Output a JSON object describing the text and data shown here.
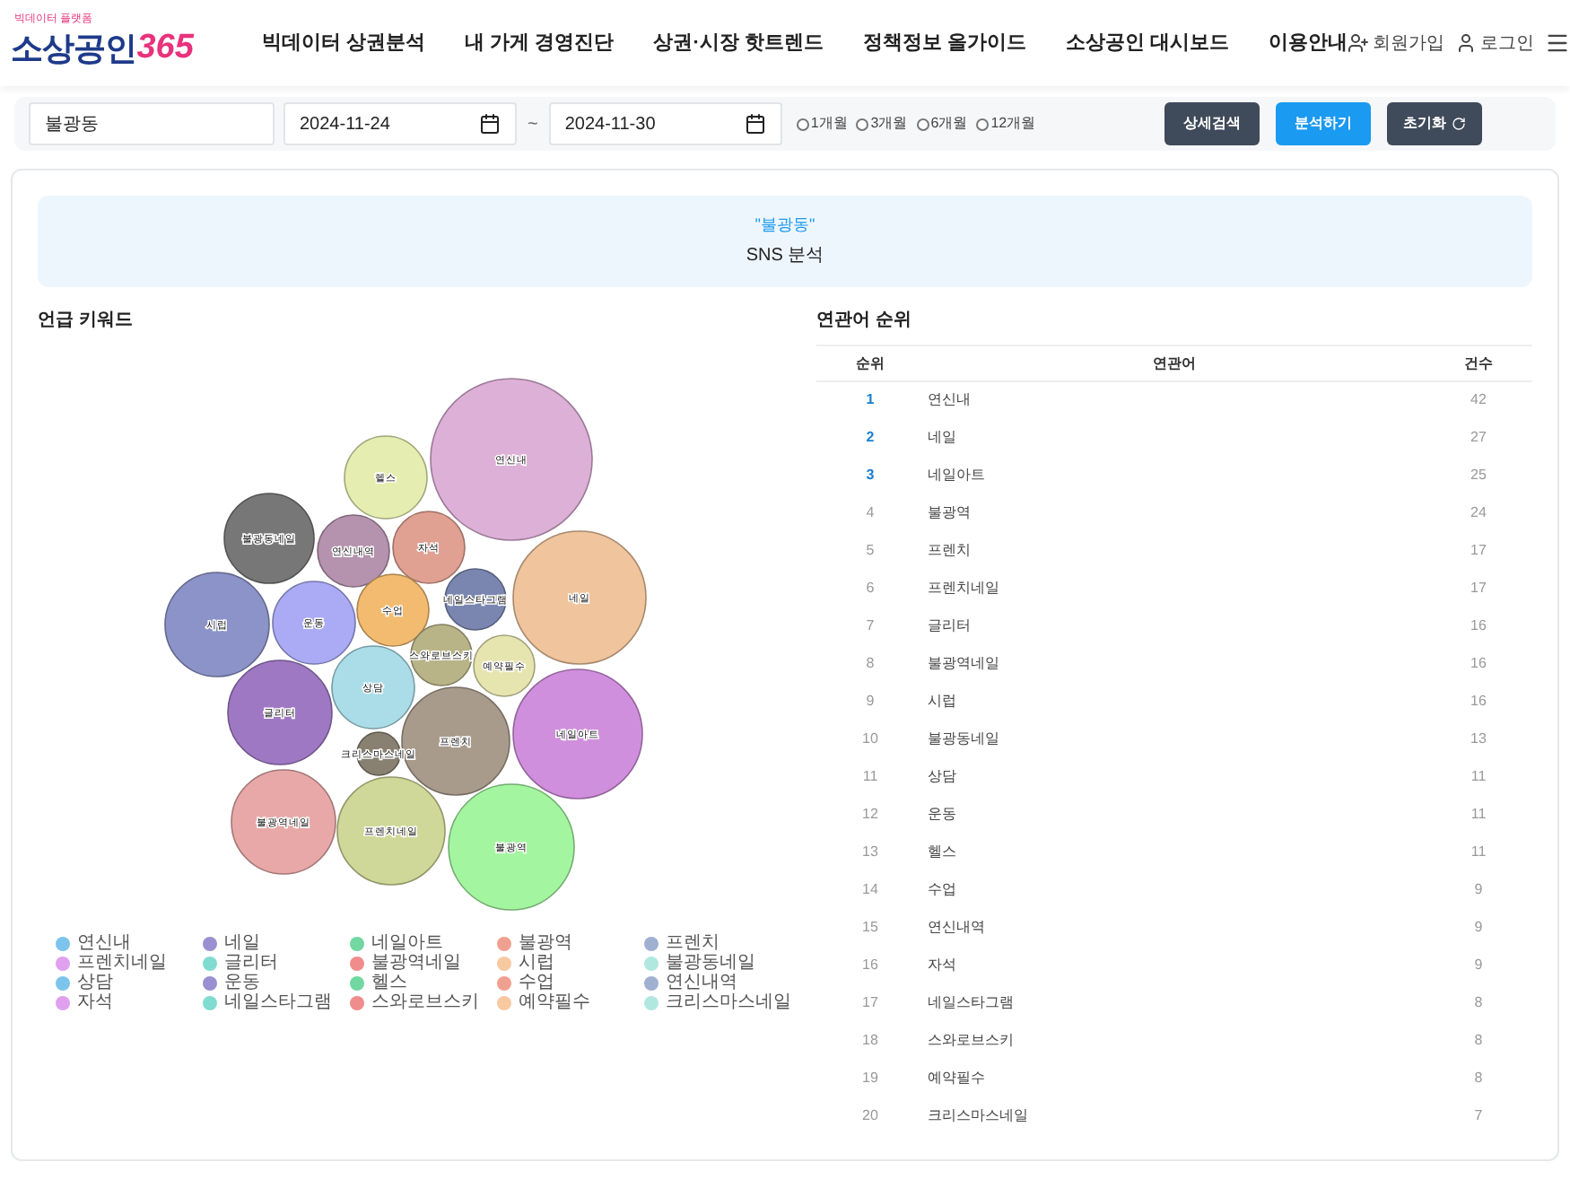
{
  "header": {
    "logo": {
      "tagline": "빅데이터 플랫폼",
      "name": "소상공인",
      "number": "365"
    },
    "nav": [
      "빅데이터 상권분석",
      "내 가게 경영진단",
      "상권·시장 핫트렌드",
      "정책정보 올가이드",
      "소상공인 대시보드",
      "이용안내"
    ],
    "user_links": [
      {
        "kind": "signup",
        "label": "회원가입"
      },
      {
        "kind": "login",
        "label": "로그인"
      }
    ]
  },
  "search": {
    "area": "불광동",
    "start_date": "2024-11-24",
    "separator": "~",
    "end_date": "2024-11-30",
    "periods": [
      {
        "label": "1개월",
        "selected": false
      },
      {
        "label": "3개월",
        "selected": false
      },
      {
        "label": "6개월",
        "selected": false
      },
      {
        "label": "12개월",
        "selected": false
      }
    ],
    "buttons": [
      {
        "kind": "detail",
        "label": "상세검색"
      },
      {
        "kind": "analyze",
        "label": "분석하기"
      },
      {
        "kind": "reset",
        "label": "초기화"
      }
    ]
  },
  "banner": {
    "keyword": "\"불광동\"",
    "subtitle": "SNS 분석"
  },
  "keywords": {
    "title": "언급 키워드",
    "bubbles": [
      {
        "label": "연신내",
        "color": "#ddb0d8"
      },
      {
        "label": "헬스",
        "color": "#e5eeb0"
      },
      {
        "label": "불광동네일",
        "color": "#777777"
      },
      {
        "label": "연신내역",
        "color": "#b592ad"
      },
      {
        "label": "자석",
        "color": "#e0a092"
      },
      {
        "label": "네일",
        "color": "#f0c49c"
      },
      {
        "label": "네일스타그램",
        "color": "#7a86b0"
      },
      {
        "label": "시럽",
        "color": "#8c93c8"
      },
      {
        "label": "운동",
        "color": "#aaaaf5"
      },
      {
        "label": "수업",
        "color": "#f2bb70"
      },
      {
        "label": "스와로브스키",
        "color": "#b8b488"
      },
      {
        "label": "예약필수",
        "color": "#e6e5b0"
      },
      {
        "label": "상담",
        "color": "#aadde8"
      },
      {
        "label": "글리터",
        "color": "#9f78c4"
      },
      {
        "label": "네일아트",
        "color": "#d08fdd"
      },
      {
        "label": "크리스마스네일",
        "color": "#888070"
      },
      {
        "label": "프렌치",
        "color": "#a89b8c"
      },
      {
        "label": "불광역네일",
        "color": "#e8a8a8"
      },
      {
        "label": "프렌치네일",
        "color": "#cfd898"
      },
      {
        "label": "불광역",
        "color": "#a4f5a0"
      }
    ],
    "legend": [
      {
        "label": "연신내",
        "color": "#7cc4ec"
      },
      {
        "label": "네일",
        "color": "#9a8fd0"
      },
      {
        "label": "네일아트",
        "color": "#70d8a0"
      },
      {
        "label": "불광역",
        "color": "#f0a090"
      },
      {
        "label": "프렌치",
        "color": "#a0b0d0"
      },
      {
        "label": "프렌치네일",
        "color": "#e0a0f0"
      },
      {
        "label": "글리터",
        "color": "#80dcd0"
      },
      {
        "label": "불광역네일",
        "color": "#f08c8c"
      },
      {
        "label": "시럽",
        "color": "#f8c8a0"
      },
      {
        "label": "불광동네일",
        "color": "#b0e8e0"
      },
      {
        "label": "상담",
        "color": "#7cc4ec"
      },
      {
        "label": "운동",
        "color": "#9a8fd0"
      },
      {
        "label": "헬스",
        "color": "#70d8a0"
      },
      {
        "label": "수업",
        "color": "#f0a090"
      },
      {
        "label": "연신내역",
        "color": "#a0b0d0"
      },
      {
        "label": "자석",
        "color": "#e0a0f0"
      },
      {
        "label": "네일스타그램",
        "color": "#80dcd0"
      },
      {
        "label": "스와로브스키",
        "color": "#f08c8c"
      },
      {
        "label": "예약필수",
        "color": "#f8c8a0"
      },
      {
        "label": "크리스마스네일",
        "color": "#b0e8e0"
      }
    ]
  },
  "ranking": {
    "title": "연관어 순위",
    "columns": [
      "순위",
      "연관어",
      "건수"
    ],
    "rows": [
      {
        "rank": "1",
        "word": "연신내",
        "count": "42",
        "top": true
      },
      {
        "rank": "2",
        "word": "네일",
        "count": "27",
        "top": true
      },
      {
        "rank": "3",
        "word": "네일아트",
        "count": "25",
        "top": true
      },
      {
        "rank": "4",
        "word": "불광역",
        "count": "24",
        "top": false
      },
      {
        "rank": "5",
        "word": "프렌치",
        "count": "17",
        "top": false
      },
      {
        "rank": "6",
        "word": "프렌치네일",
        "count": "17",
        "top": false
      },
      {
        "rank": "7",
        "word": "글리터",
        "count": "16",
        "top": false
      },
      {
        "rank": "8",
        "word": "불광역네일",
        "count": "16",
        "top": false
      },
      {
        "rank": "9",
        "word": "시럽",
        "count": "16",
        "top": false
      },
      {
        "rank": "10",
        "word": "불광동네일",
        "count": "13",
        "top": false
      },
      {
        "rank": "11",
        "word": "상담",
        "count": "11",
        "top": false
      },
      {
        "rank": "12",
        "word": "운동",
        "count": "11",
        "top": false
      },
      {
        "rank": "13",
        "word": "헬스",
        "count": "11",
        "top": false
      },
      {
        "rank": "14",
        "word": "수업",
        "count": "9",
        "top": false
      },
      {
        "rank": "15",
        "word": "연신내역",
        "count": "9",
        "top": false
      },
      {
        "rank": "16",
        "word": "자석",
        "count": "9",
        "top": false
      },
      {
        "rank": "17",
        "word": "네일스타그램",
        "count": "8",
        "top": false
      },
      {
        "rank": "18",
        "word": "스와로브스키",
        "count": "8",
        "top": false
      },
      {
        "rank": "19",
        "word": "예약필수",
        "count": "8",
        "top": false
      },
      {
        "rank": "20",
        "word": "크리스마스네일",
        "count": "7",
        "top": false
      }
    ]
  }
}
